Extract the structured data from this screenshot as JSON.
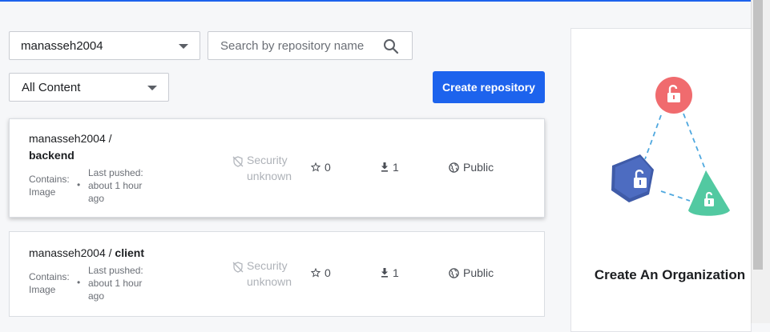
{
  "filters": {
    "namespace": "manasseh2004",
    "content": "All Content",
    "search_placeholder": "Search by repository name"
  },
  "actions": {
    "create_repository": "Create repository"
  },
  "repositories": [
    {
      "owner": "manasseh2004 /",
      "name": "backend",
      "contains_label": "Contains:",
      "contains_value": "Image",
      "bullet": "•",
      "last_pushed_label": "Last pushed:",
      "last_pushed_value": "about 1 hour ago",
      "security": "Security unknown",
      "stars": "0",
      "pulls": "1",
      "visibility": "Public"
    },
    {
      "owner": "manasseh2004 /",
      "name": "client",
      "contains_label": "Contains:",
      "contains_value": "Image",
      "bullet": "•",
      "last_pushed_label": "Last pushed:",
      "last_pushed_value": "about 1 hour ago",
      "security": "Security unknown",
      "stars": "0",
      "pulls": "1",
      "visibility": "Public"
    }
  ],
  "side_panel": {
    "title": "Create An Organization"
  },
  "colors": {
    "accent": "#1d63ed",
    "red_node": "#f06b6e",
    "blue_node": "#4d6cc1",
    "green_node": "#52c9a1"
  },
  "icons": [
    "chevron-down-icon",
    "search-icon",
    "shield-off-icon",
    "star-icon",
    "download-icon",
    "globe-icon",
    "lock-icon"
  ]
}
